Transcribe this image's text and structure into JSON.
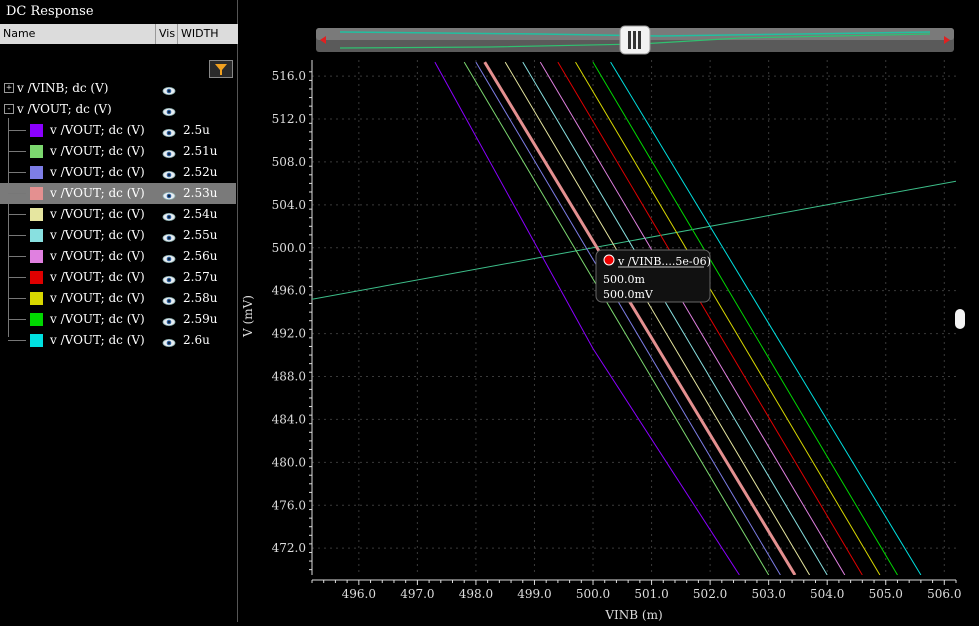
{
  "panel": {
    "title": "DC Response",
    "columns": [
      "Name",
      "Vis",
      "WIDTH"
    ],
    "parents": [
      {
        "label": "v /VINB; dc (V)",
        "expand": "+"
      },
      {
        "label": "v /VOUT; dc (V)",
        "expand": "-"
      }
    ],
    "children": [
      {
        "label": "v /VOUT; dc (V)",
        "width": "2.5u",
        "color": "#8b00ff"
      },
      {
        "label": "v /VOUT; dc (V)",
        "width": "2.51u",
        "color": "#7cd86f"
      },
      {
        "label": "v /VOUT; dc (V)",
        "width": "2.52u",
        "color": "#7d7de6"
      },
      {
        "label": "v /VOUT; dc (V)",
        "width": "2.53u",
        "color": "#e49090"
      },
      {
        "label": "v /VOUT; dc (V)",
        "width": "2.54u",
        "color": "#e6e6a0"
      },
      {
        "label": "v /VOUT; dc (V)",
        "width": "2.55u",
        "color": "#88e0e0"
      },
      {
        "label": "v /VOUT; dc (V)",
        "width": "2.56u",
        "color": "#e080e0"
      },
      {
        "label": "v /VOUT; dc (V)",
        "width": "2.57u",
        "color": "#e00000"
      },
      {
        "label": "v /VOUT; dc (V)",
        "width": "2.58u",
        "color": "#d8d800"
      },
      {
        "label": "v /VOUT; dc (V)",
        "width": "2.59u",
        "color": "#00d800"
      },
      {
        "label": "v /VOUT; dc (V)",
        "width": "2.6u",
        "color": "#00e0e0"
      }
    ],
    "selected_index": 3
  },
  "marker": {
    "title": "v /VINB....5e-06)",
    "x_readout": "500.0m",
    "y_readout": "500.0mV"
  },
  "chart_data": {
    "type": "line",
    "xlabel": "VINB (m)",
    "ylabel": "V (mV)",
    "xlim": [
      495.2,
      506.2
    ],
    "ylim": [
      469.5,
      517.5
    ],
    "xticks": [
      "496.0",
      "497.0",
      "498.0",
      "499.0",
      "500.0",
      "501.0",
      "502.0",
      "503.0",
      "504.0",
      "505.0",
      "506.0"
    ],
    "yticks": [
      "472.0",
      "476.0",
      "480.0",
      "484.0",
      "488.0",
      "492.0",
      "496.0",
      "500.0",
      "504.0",
      "508.0",
      "512.0",
      "516.0"
    ],
    "grid": true,
    "series": [
      {
        "name": "v /VINB; dc (V)",
        "color": "#3dbf8a",
        "x": [
          495.2,
          506.2
        ],
        "y": [
          495.2,
          506.2
        ]
      },
      {
        "name": "2.5u",
        "color": "#8b00ff",
        "x": [
          497.3,
          500.0,
          502.5
        ],
        "y": [
          517.3,
          490.6,
          469.5
        ]
      },
      {
        "name": "2.51u",
        "color": "#7cd86f",
        "x": [
          497.8,
          503.0
        ],
        "y": [
          517.3,
          469.5
        ]
      },
      {
        "name": "2.52u",
        "color": "#7d7de6",
        "x": [
          498.0,
          503.2
        ],
        "y": [
          517.3,
          469.5
        ]
      },
      {
        "name": "2.53u",
        "color": "#e49090",
        "x": [
          498.15,
          503.45
        ],
        "y": [
          517.3,
          469.5
        ]
      },
      {
        "name": "2.54u",
        "color": "#e6e6a0",
        "x": [
          498.5,
          503.7
        ],
        "y": [
          517.3,
          469.5
        ]
      },
      {
        "name": "2.55u",
        "color": "#88e0e0",
        "x": [
          498.8,
          504.0
        ],
        "y": [
          517.3,
          469.5
        ]
      },
      {
        "name": "2.56u",
        "color": "#e080e0",
        "x": [
          499.1,
          504.3
        ],
        "y": [
          517.3,
          469.5
        ]
      },
      {
        "name": "2.57u",
        "color": "#e00000",
        "x": [
          499.4,
          504.6
        ],
        "y": [
          517.3,
          469.5
        ]
      },
      {
        "name": "2.58u",
        "color": "#d8d800",
        "x": [
          499.7,
          504.9
        ],
        "y": [
          517.3,
          469.5
        ]
      },
      {
        "name": "2.59u",
        "color": "#00d800",
        "x": [
          500.0,
          505.2
        ],
        "y": [
          517.3,
          469.5
        ]
      },
      {
        "name": "2.6u",
        "color": "#00e0e0",
        "x": [
          500.3,
          505.6
        ],
        "y": [
          517.3,
          469.5
        ]
      }
    ]
  }
}
